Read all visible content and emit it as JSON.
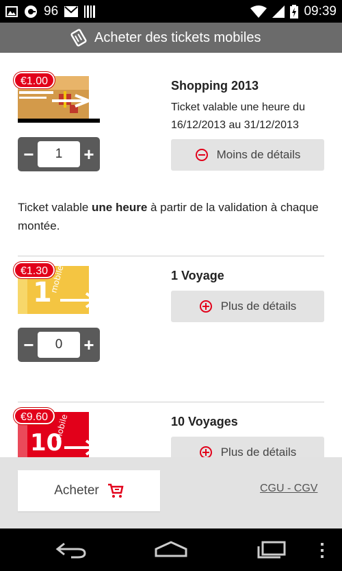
{
  "status_bar": {
    "notification_count": "96",
    "time": "09:39",
    "icons": [
      "image-icon",
      "circle-app-icon",
      "mail-icon",
      "barcode-icon",
      "wifi-icon",
      "signal-icon",
      "battery-charging-icon"
    ]
  },
  "action_bar": {
    "title": "Acheter des tickets mobiles",
    "icon": "ticket-icon"
  },
  "tickets": [
    {
      "price": "€1.00",
      "name": "Shopping 2013",
      "description": "Ticket valable une heure du 16/12/2013 au 31/12/2013",
      "details_label": "Moins de détails",
      "details_icon": "minus-circle-icon",
      "quantity": "1",
      "long_description_pre": "Ticket valable ",
      "long_description_bold": "une heure",
      "long_description_post": " à partir de la validation à chaque montée."
    },
    {
      "price": "€1.30",
      "name": "1 Voyage",
      "details_label": "Plus de détails",
      "details_icon": "plus-circle-icon",
      "quantity": "0"
    },
    {
      "price": "€9.60",
      "name": "10 Voyages",
      "details_label": "Plus de détails",
      "details_icon": "plus-circle-icon"
    }
  ],
  "stepper": {
    "minus": "−",
    "plus": "+"
  },
  "bottom": {
    "buy_label": "Acheter",
    "buy_icon": "cart-icon",
    "cgu_link": "CGU - CGV"
  },
  "nav_bar": {
    "icons": [
      "back-icon",
      "home-icon",
      "recents-icon",
      "overflow-menu-icon"
    ]
  },
  "colors": {
    "accent": "#e2001a",
    "action_bar": "#6b6b6b",
    "button_bg": "#e3e3e3",
    "stepper_bg": "#5a5a5a"
  }
}
